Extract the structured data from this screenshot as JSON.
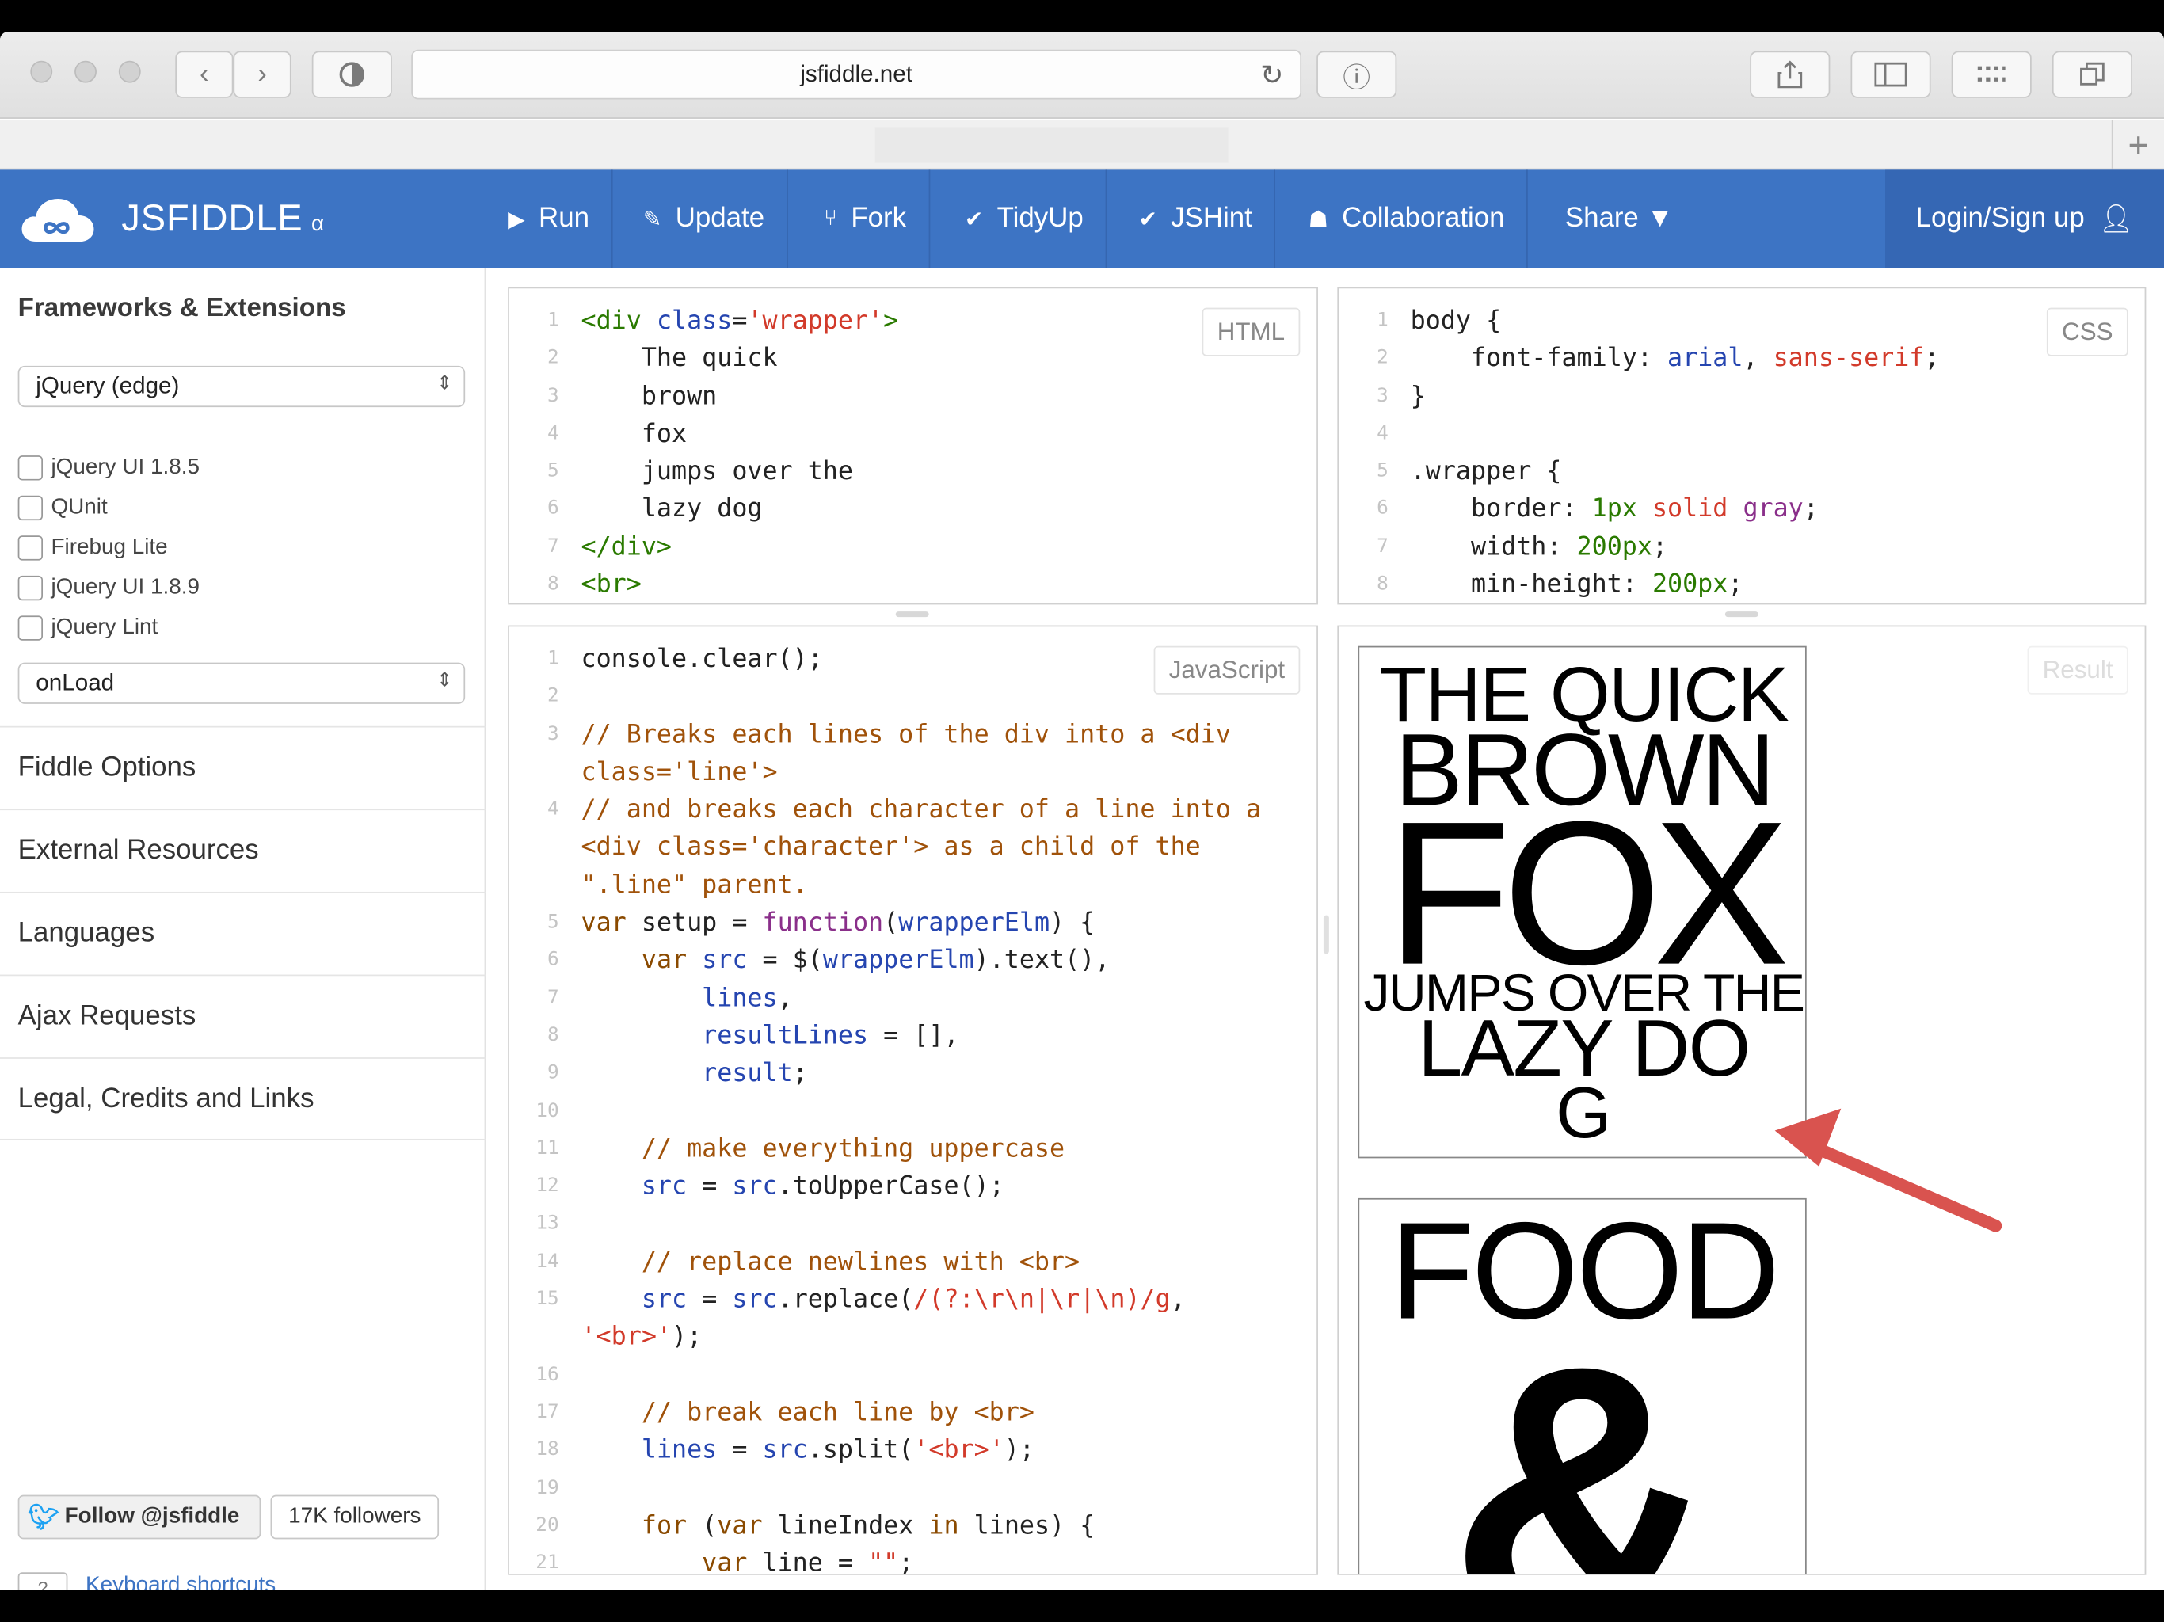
{
  "browser": {
    "url": "jsfiddle.net",
    "new_tab": "+"
  },
  "nav": {
    "brand": "JSFIDDLE",
    "brand_suffix": "α",
    "run": "Run",
    "update": "Update",
    "fork": "Fork",
    "tidyup": "TidyUp",
    "jshint": "JSHint",
    "collaboration": "Collaboration",
    "share": "Share ▼",
    "login": "Login/Sign up"
  },
  "sidebar": {
    "title": "Frameworks & Extensions",
    "framework_select": "jQuery (edge)",
    "extensions": [
      "jQuery UI 1.8.5",
      "QUnit",
      "Firebug Lite",
      "jQuery UI 1.8.9",
      "jQuery Lint"
    ],
    "load_select": "onLoad",
    "sections": [
      "Fiddle Options",
      "External Resources",
      "Languages",
      "Ajax Requests",
      "Legal, Credits and Links"
    ],
    "follow": "Follow @jsfiddle",
    "followers": "17K followers",
    "kbd": "?",
    "kbd_link": "Keyboard shortcuts"
  },
  "panels": {
    "html_label": "HTML",
    "css_label": "CSS",
    "js_label": "JavaScript",
    "result_label": "Result"
  },
  "result": {
    "box1": [
      "THE QUICK",
      "BROWN",
      "FOX",
      "JUMPS OVER THE",
      "LAZY DO",
      "G"
    ],
    "box2": [
      "FOOD",
      "&"
    ]
  },
  "colors": {
    "nav_blue": "#3d74c4",
    "arrow_red": "#d9534f"
  }
}
